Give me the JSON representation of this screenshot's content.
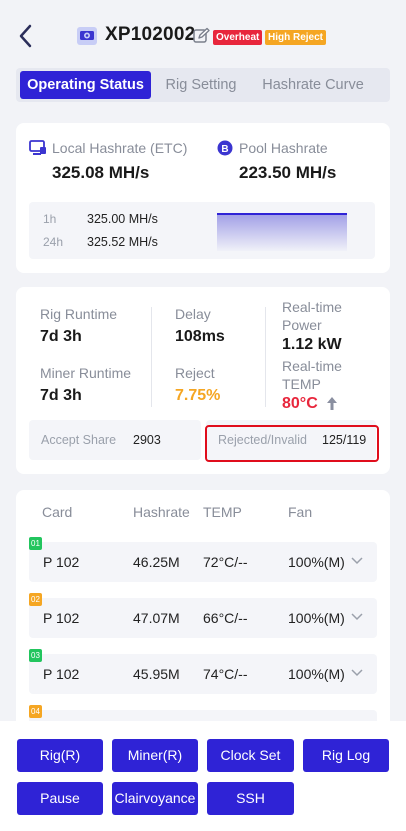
{
  "header": {
    "title": "XP102002",
    "badges": [
      "Overheat",
      "High Reject"
    ],
    "badge_colors": [
      "#e8263c",
      "#f5a623"
    ],
    "back_icon": "chevron-left-icon",
    "device_icon": "gpu-card-icon",
    "edit_icon": "edit-icon"
  },
  "tabs": [
    {
      "label": "Operating Status",
      "active": true
    },
    {
      "label": "Rig Setting",
      "active": false
    },
    {
      "label": "Hashrate Curve",
      "active": false
    }
  ],
  "hashrate": {
    "local_label": "Local Hashrate (ETC)",
    "local_value": "325.08 MH/s",
    "pool_label": "Pool Hashrate",
    "pool_value": "223.50 MH/s",
    "stats": [
      {
        "period": "1h",
        "value": "325.00 MH/s"
      },
      {
        "period": "24h",
        "value": "325.52 MH/s"
      }
    ]
  },
  "status": {
    "rig_runtime_label": "Rig Runtime",
    "rig_runtime_value": "7d 3h",
    "delay_label": "Delay",
    "delay_value": "108ms",
    "power_label": "Real-time Power",
    "power_value": "1.12 kW",
    "miner_runtime_label": "Miner Runtime",
    "miner_runtime_value": "7d 3h",
    "reject_label": "Reject",
    "reject_value": "7.75%",
    "temp_label": "Real-time TEMP",
    "temp_value": "80°C",
    "accept_label": "Accept Share",
    "accept_value": "2903",
    "rejected_label": "Rejected/Invalid",
    "rejected_value": "125/119",
    "reject_color": "#f5a623",
    "temp_color": "#e8263c"
  },
  "cards_table": {
    "headers": [
      "Card",
      "Hashrate",
      "TEMP",
      "Fan"
    ],
    "rows": [
      {
        "index": "01",
        "color": "#22c55e",
        "card": "P 102",
        "hashrate": "46.25M",
        "temp": "72°C/--",
        "fan": "100%(M)"
      },
      {
        "index": "02",
        "color": "#f5a623",
        "card": "P 102",
        "hashrate": "47.07M",
        "temp": "66°C/--",
        "fan": "100%(M)"
      },
      {
        "index": "03",
        "color": "#22c55e",
        "card": "P 102",
        "hashrate": "45.95M",
        "temp": "74°C/--",
        "fan": "100%(M)"
      },
      {
        "index": "04",
        "color": "#f5a623",
        "card": "",
        "hashrate": "",
        "temp": "",
        "fan": ""
      }
    ]
  },
  "actions": [
    "Rig(R)",
    "Miner(R)",
    "Clock Set",
    "Rig Log",
    "Pause",
    "Clairvoyance",
    "SSH"
  ],
  "accent_color": "#2f23d6"
}
